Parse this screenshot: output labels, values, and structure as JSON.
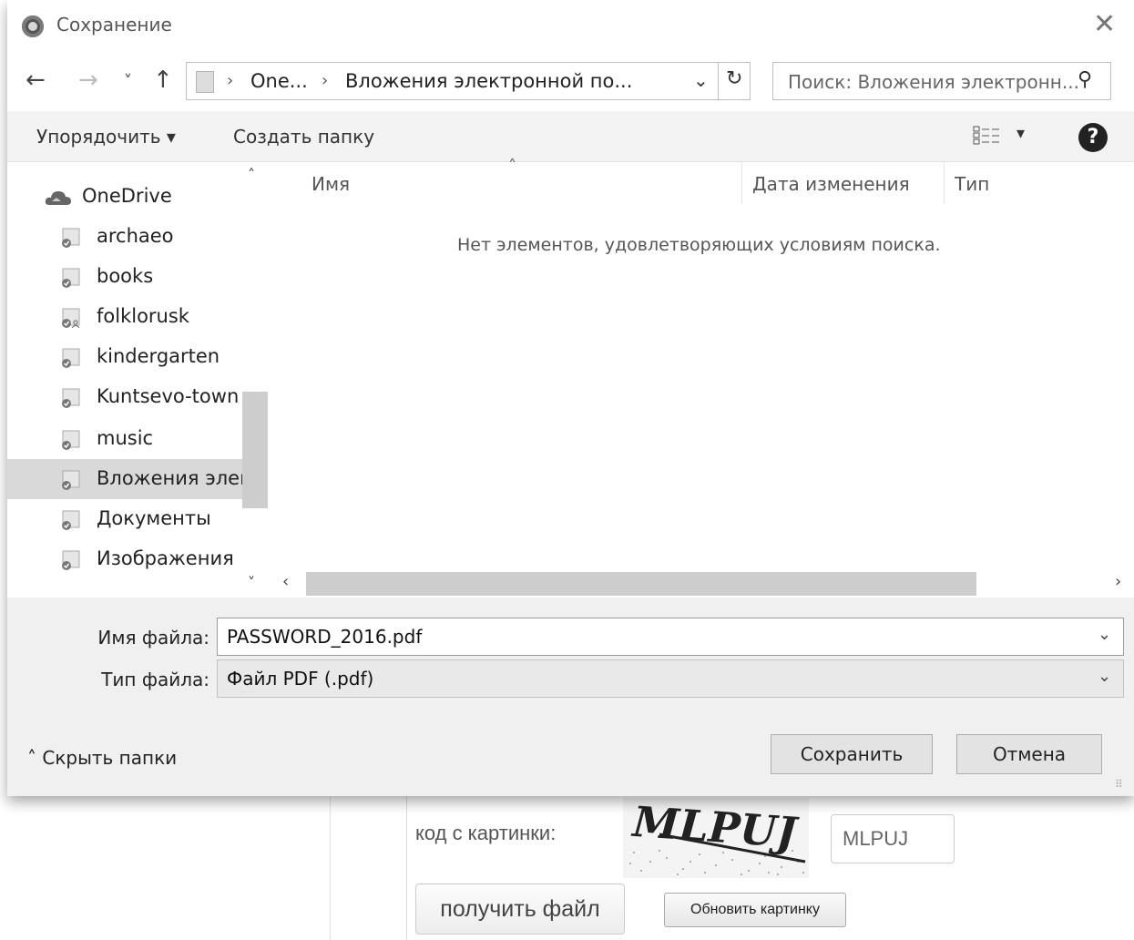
{
  "dialog": {
    "title": "Сохранение",
    "close_glyph": "✕"
  },
  "nav": {
    "back_glyph": "←",
    "forward_glyph": "→",
    "recent_glyph": "˅",
    "up_glyph": "↑",
    "breadcrumbs": [
      "One...",
      "Вложения электронной по..."
    ],
    "crumb_separator": "›",
    "dropdown_glyph": "⌄",
    "refresh_glyph": "↻",
    "search_placeholder": "Поиск: Вложения электронн...",
    "search_glyph": "⚲"
  },
  "toolbar": {
    "organize_label": "Упорядочить ▾",
    "new_folder_label": "Создать папку",
    "view_dropdown_glyph": "▾",
    "help_glyph": "?"
  },
  "tree": {
    "items": [
      {
        "label": "OneDrive",
        "icon": "cloud-icon"
      },
      {
        "label": "archaeo",
        "icon": "synced-folder-icon"
      },
      {
        "label": "books",
        "icon": "synced-folder-icon"
      },
      {
        "label": "folklorusk",
        "icon": "shared-folder-icon"
      },
      {
        "label": "kindergarten",
        "icon": "synced-folder-icon"
      },
      {
        "label": "Kuntsevo-town",
        "icon": "synced-folder-icon"
      },
      {
        "label": "music",
        "icon": "synced-folder-icon"
      },
      {
        "label": "Вложения элект",
        "icon": "synced-folder-icon",
        "selected": true
      },
      {
        "label": "Документы",
        "icon": "synced-folder-icon"
      },
      {
        "label": "Изображения",
        "icon": "synced-folder-icon"
      }
    ],
    "scroll_up_glyph": "˄",
    "scroll_down_glyph": "˅"
  },
  "filelist": {
    "columns": [
      "Имя",
      "Дата изменения",
      "Тип"
    ],
    "sort_glyph": "˄",
    "empty_message": "Нет элементов, удовлетворяющих условиям поиска.",
    "scroll_left_glyph": "‹",
    "scroll_right_glyph": "›"
  },
  "form": {
    "filename_label": "Имя файла:",
    "filename_value": "PASSWORD_2016.pdf",
    "filetype_label": "Тип файла:",
    "filetype_value": "Файл PDF (.pdf)",
    "dropdown_glyph": "⌄",
    "hide_folders_label": "˄  Скрыть папки",
    "save_label": "Сохранить",
    "cancel_label": "Отмена",
    "grip_glyph": "⠿"
  },
  "background_page": {
    "captcha_label": "код с картинки:",
    "captcha_text": "MLPUJ",
    "captcha_input_value": "MLPUJ",
    "get_file_label": "получить файл",
    "refresh_image_label": "Обновить картинку"
  }
}
